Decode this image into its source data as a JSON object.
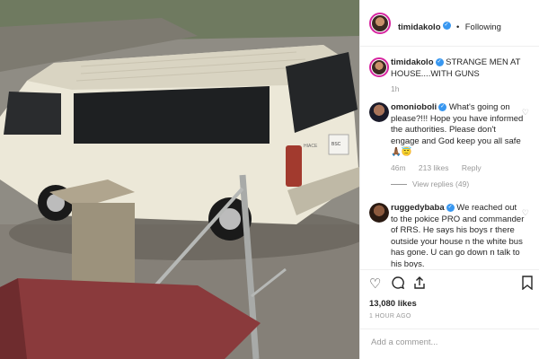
{
  "post": {
    "image_alt": "White minibus parked outside a house",
    "van_plate_text": "BSC",
    "van_badge_text": "HIACE"
  },
  "header": {
    "username": "timidakolo",
    "separator": "•",
    "follow_label": "Following"
  },
  "caption": {
    "username": "timidakolo",
    "text": "STRANGE MEN AT HOUSE....WITH GUNS",
    "time": "1h"
  },
  "comments": [
    {
      "username": "omonioboli",
      "text": "What's going on please?!!! Hope you have informed the authorities. Please don't engage and God keep you all safe 🙏🏾😇",
      "time": "46m",
      "likes": "213 likes",
      "reply_label": "Reply",
      "view_replies": "View replies (49)"
    },
    {
      "username": "ruggedybaba",
      "text": "We reached out to the pokice PRO and commander of RRS. He says his boys r there outside your house n the white bus has gone. U can go down n talk to his boys."
    }
  ],
  "actions": {
    "like_icon": "heart-icon",
    "comment_icon": "comment-icon",
    "share_icon": "share-icon",
    "save_icon": "bookmark-icon",
    "likes_count": "13,080 likes",
    "timestamp": "1 HOUR AGO"
  },
  "add_comment": {
    "placeholder": "Add a comment..."
  },
  "colors": {
    "verified": "#3897f0",
    "ring": "#d6249f",
    "text": "#262626",
    "muted": "#999999"
  }
}
